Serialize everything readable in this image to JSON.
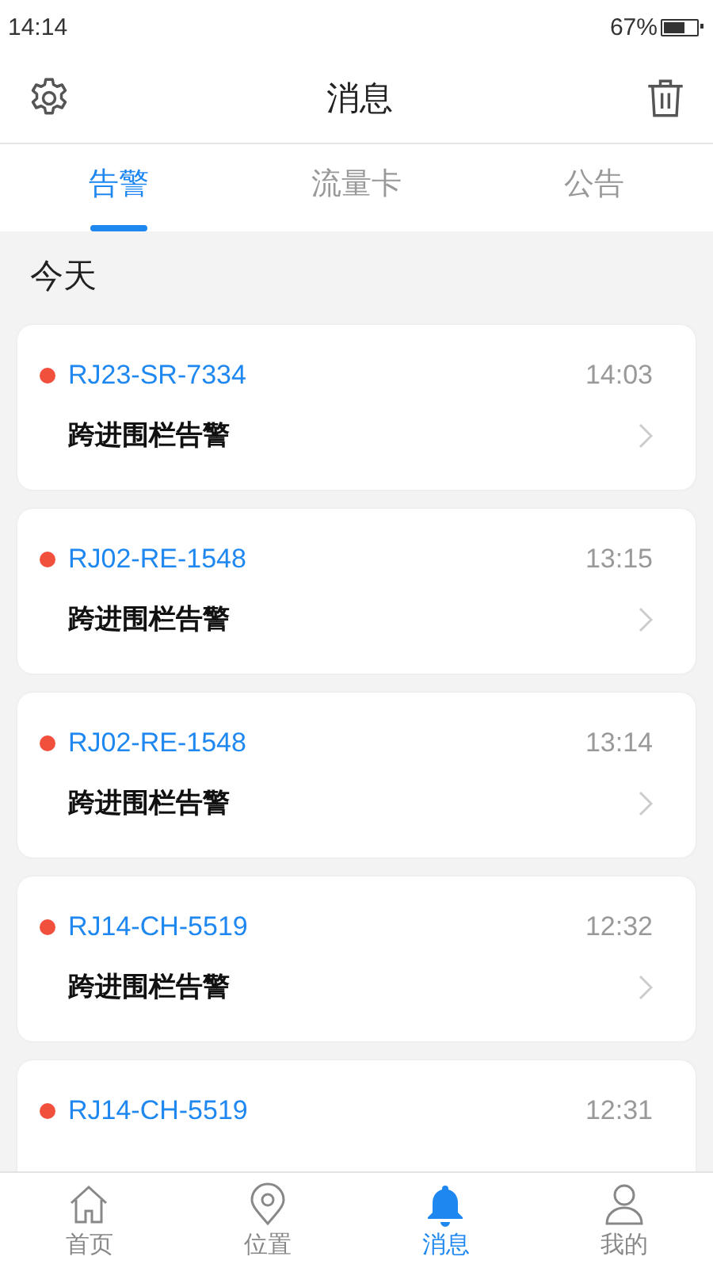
{
  "status_bar": {
    "time": "14:14",
    "battery_text": "67%"
  },
  "header": {
    "title": "消息"
  },
  "tabs": [
    {
      "label": "告警",
      "selected": true
    },
    {
      "label": "流量卡",
      "selected": false
    },
    {
      "label": "公告",
      "selected": false
    }
  ],
  "section_title": "今天",
  "alerts": [
    {
      "device": "RJ23-SR-7334",
      "time": "14:03",
      "message": "跨进围栏告警",
      "unread": true
    },
    {
      "device": "RJ02-RE-1548",
      "time": "13:15",
      "message": "跨进围栏告警",
      "unread": true
    },
    {
      "device": "RJ02-RE-1548",
      "time": "13:14",
      "message": "跨进围栏告警",
      "unread": true
    },
    {
      "device": "RJ14-CH-5519",
      "time": "12:32",
      "message": "跨进围栏告警",
      "unread": true
    },
    {
      "device": "RJ14-CH-5519",
      "time": "12:31",
      "unread": true
    }
  ],
  "bottom_nav": [
    {
      "label": "首页",
      "kind": "home",
      "selected": false
    },
    {
      "label": "位置",
      "kind": "location",
      "selected": false
    },
    {
      "label": "消息",
      "kind": "bell",
      "selected": true
    },
    {
      "label": "我的",
      "kind": "profile",
      "selected": false
    }
  ]
}
